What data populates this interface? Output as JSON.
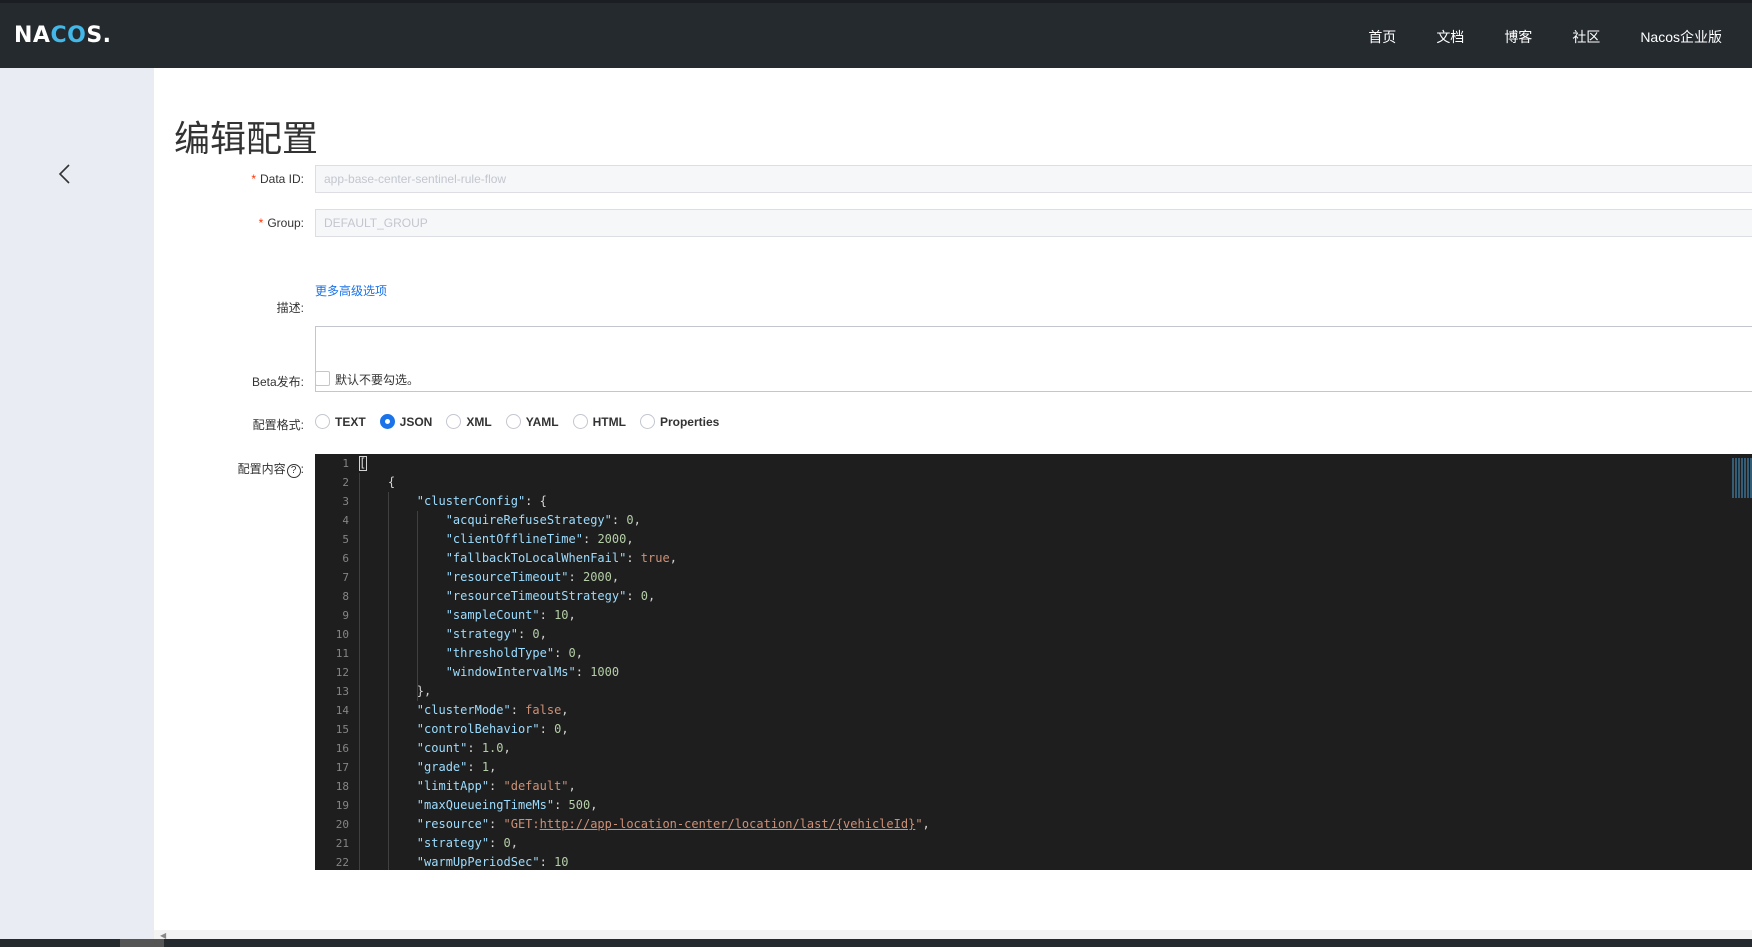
{
  "header": {
    "logo_pre": "NA",
    "logo_mid": "CO",
    "logo_post": "S.",
    "nav": [
      "首页",
      "文档",
      "博客",
      "社区",
      "Nacos企业版"
    ]
  },
  "page": {
    "title": "编辑配置"
  },
  "form": {
    "data_id_label": "Data ID:",
    "data_id_value": "app-base-center-sentinel-rule-flow",
    "group_label": "Group:",
    "group_value": "DEFAULT_GROUP",
    "advanced_link": "更多高级选项",
    "desc_label": "描述:",
    "beta_label": "Beta发布:",
    "beta_checkbox_text": "默认不要勾选。",
    "format_label": "配置格式:",
    "formats": [
      "TEXT",
      "JSON",
      "XML",
      "YAML",
      "HTML",
      "Properties"
    ],
    "selected_format": "JSON",
    "content_label": "配置内容",
    "help_glyph": "?"
  },
  "editor": {
    "lines": [
      "[",
      "    {",
      "        \"clusterConfig\": {",
      "            \"acquireRefuseStrategy\": 0,",
      "            \"clientOfflineTime\": 2000,",
      "            \"fallbackToLocalWhenFail\": true,",
      "            \"resourceTimeout\": 2000,",
      "            \"resourceTimeoutStrategy\": 0,",
      "            \"sampleCount\": 10,",
      "            \"strategy\": 0,",
      "            \"thresholdType\": 0,",
      "            \"windowIntervalMs\": 1000",
      "        },",
      "        \"clusterMode\": false,",
      "        \"controlBehavior\": 0,",
      "        \"count\": 1.0,",
      "        \"grade\": 1,",
      "        \"limitApp\": \"default\",",
      "        \"maxQueueingTimeMs\": 500,",
      "        \"resource\": \"GET:http://app-location-center/location/last/{vehicleId}\",",
      "        \"strategy\": 0,",
      "        \"warmUpPeriodSec\": 10"
    ]
  }
}
